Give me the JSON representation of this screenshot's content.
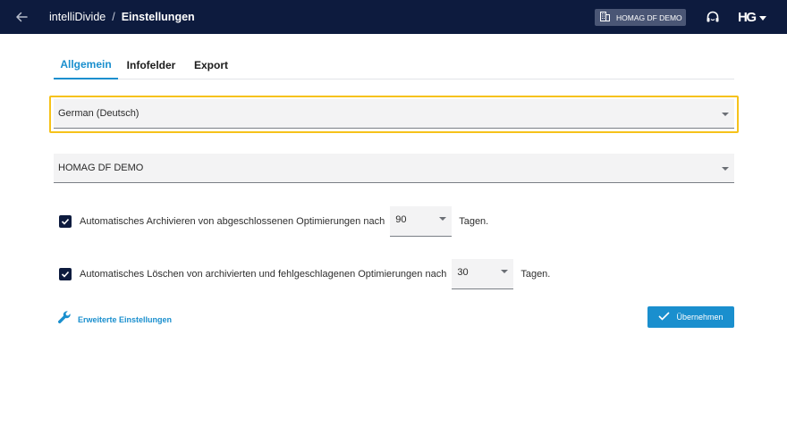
{
  "header": {
    "app_name": "intelliDivide",
    "separator": "/",
    "current_page": "Einstellungen",
    "company_badge": "HOMAG DF DEMO",
    "logo_text": "HG",
    "background_color": "#0d1b3e"
  },
  "tabs": [
    {
      "label": "Allgemein",
      "active": true
    },
    {
      "label": "Infofelder",
      "active": false
    },
    {
      "label": "Export",
      "active": false
    }
  ],
  "language_select": {
    "value": "German (Deutsch)"
  },
  "company_select": {
    "value": "HOMAG DF DEMO"
  },
  "auto_archive": {
    "checked": true,
    "label": "Automatisches Archivieren von abgeschlossenen Optimierungen nach",
    "days_value": "90",
    "suffix": "Tagen."
  },
  "auto_delete": {
    "checked": true,
    "label": "Automatisches Löschen von archivierten und fehlgeschlagenen Optimierungen nach",
    "days_value": "30",
    "suffix": "Tagen."
  },
  "actions": {
    "advanced_settings": "Erweiterte Einstellungen",
    "apply": "Übernehmen"
  },
  "colors": {
    "accent": "#1a8fce",
    "focus": "#f6c21a",
    "navy": "#0d1b3e"
  },
  "icons": [
    "back-arrow-icon",
    "building-icon",
    "headset-icon",
    "chevron-down-icon",
    "checkmark-icon",
    "wrench-icon"
  ]
}
